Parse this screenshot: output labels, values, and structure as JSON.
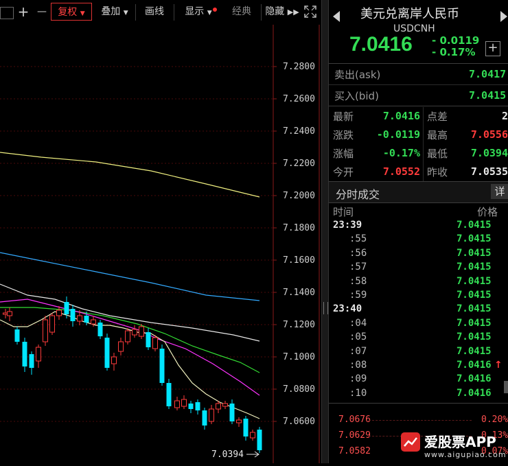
{
  "toolbar": {
    "restore_label": "复权",
    "overlay_label": "叠加",
    "draw_label": "画线",
    "display_label": "显示",
    "classic_label": "经典",
    "hide_label": "隐藏",
    "plus_label": "+",
    "minus_label": "—"
  },
  "chart": {
    "price_ticks": [
      "7.2800",
      "7.2600",
      "7.2400",
      "7.2200",
      "7.2000",
      "7.1800",
      "7.1600",
      "7.1400",
      "7.1200",
      "7.1000",
      "7.0800",
      "7.0600"
    ],
    "low_marker": "7.0394",
    "colors": {
      "bg": "#000000",
      "grid": "#3a0000",
      "up": "#ff3b3b",
      "down": "#00e5ff",
      "ma1": "#f2f2c0",
      "ma2": "#f0f080",
      "ma3": "#ff33ff",
      "ma4": "#33dd33",
      "ma5": "#ffffff",
      "ma6": "#33aaff"
    }
  },
  "quote": {
    "title": "美元兑离岸人民币",
    "symbol": "USDCNH",
    "price": "7.0416",
    "change": "- 0.0119",
    "change_pct": "- 0.17%",
    "add_label": "+",
    "ask_label": "卖出(ask)",
    "ask_value": "7.0417",
    "bid_label": "买入(bid)",
    "bid_value": "7.0415",
    "stats": [
      {
        "l1": "最新",
        "v1": "7.0416",
        "c1": "green",
        "l2": "点差",
        "v2": "2",
        "c2": "white"
      },
      {
        "l1": "涨跌",
        "v1": "-0.0119",
        "c1": "green",
        "l2": "最高",
        "v2": "7.0556",
        "c2": "red"
      },
      {
        "l1": "涨幅",
        "v1": "-0.17%",
        "c1": "green",
        "l2": "最低",
        "v2": "7.0394",
        "c2": "green"
      },
      {
        "l1": "今开",
        "v1": "7.0552",
        "c1": "red",
        "l2": "昨收",
        "v2": "7.0535",
        "c2": "white"
      }
    ],
    "trades_title": "分时成交",
    "detail_label": "详",
    "col_time": "时间",
    "col_price": "价格",
    "trades": [
      {
        "t": "23:39",
        "p": "7.0415",
        "bold": true
      },
      {
        "t": ":55",
        "p": "7.0415"
      },
      {
        "t": ":56",
        "p": "7.0415"
      },
      {
        "t": ":57",
        "p": "7.0415"
      },
      {
        "t": ":58",
        "p": "7.0415"
      },
      {
        "t": ":59",
        "p": "7.0415"
      },
      {
        "t": "23:40",
        "p": "7.0415",
        "bold": true
      },
      {
        "t": ":04",
        "p": "7.0415"
      },
      {
        "t": ":05",
        "p": "7.0415"
      },
      {
        "t": ":07",
        "p": "7.0415"
      },
      {
        "t": ":08",
        "p": "7.0416",
        "up": true
      },
      {
        "t": ":09",
        "p": "7.0416"
      },
      {
        "t": ":10",
        "p": "7.0416"
      }
    ],
    "mini_prices": [
      "7.0676",
      "7.0629",
      "7.0582"
    ],
    "mini_pcts": [
      "0.20%",
      "0.13%",
      "0.07%"
    ]
  },
  "watermark": {
    "brand": "爱股票APP",
    "url": "www.aigupiao.com"
  }
}
